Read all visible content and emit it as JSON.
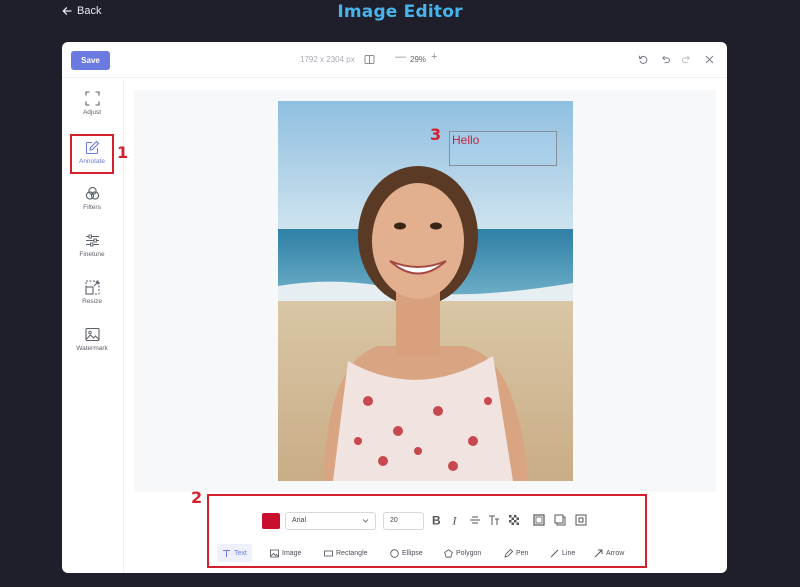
{
  "header": {
    "back_label": "Back",
    "title": "Image Editor"
  },
  "topbar": {
    "save_label": "Save",
    "dimensions": "1792 x 2304 px",
    "zoom_minus": "—",
    "zoom": "29%",
    "zoom_plus": "+"
  },
  "sidebar": {
    "items": [
      {
        "label": "Adjust",
        "icon": "crop-icon"
      },
      {
        "label": "Annotate",
        "icon": "edit-icon",
        "active": true
      },
      {
        "label": "Filters",
        "icon": "filters-icon"
      },
      {
        "label": "Finetune",
        "icon": "sliders-icon"
      },
      {
        "label": "Resize",
        "icon": "resize-icon"
      },
      {
        "label": "Watermark",
        "icon": "image-icon"
      }
    ]
  },
  "canvas": {
    "annotation_text": "Hello"
  },
  "annotation_tools": {
    "color": "#c8102e",
    "font": "Arial",
    "font_size": "20",
    "format_buttons": [
      "bold-icon",
      "italic-icon",
      "strikethrough-icon",
      "text-size-icon",
      "transparency-icon",
      "background-box-icon",
      "shadow-icon",
      "outline-icon"
    ],
    "tools": [
      {
        "label": "Text",
        "icon": "text-icon",
        "active": true
      },
      {
        "label": "Image",
        "icon": "image-icon"
      },
      {
        "label": "Rectangle",
        "icon": "rectangle-icon"
      },
      {
        "label": "Ellipse",
        "icon": "ellipse-icon"
      },
      {
        "label": "Polygon",
        "icon": "polygon-icon"
      },
      {
        "label": "Pen",
        "icon": "pen-icon"
      },
      {
        "label": "Line",
        "icon": "line-icon"
      },
      {
        "label": "Arrow",
        "icon": "arrow-icon"
      }
    ]
  },
  "markers": [
    "1",
    "2",
    "3"
  ],
  "colors": {
    "accent": "#6b7ae0",
    "highlight": "#d51f2c",
    "title": "#47b4ec"
  }
}
